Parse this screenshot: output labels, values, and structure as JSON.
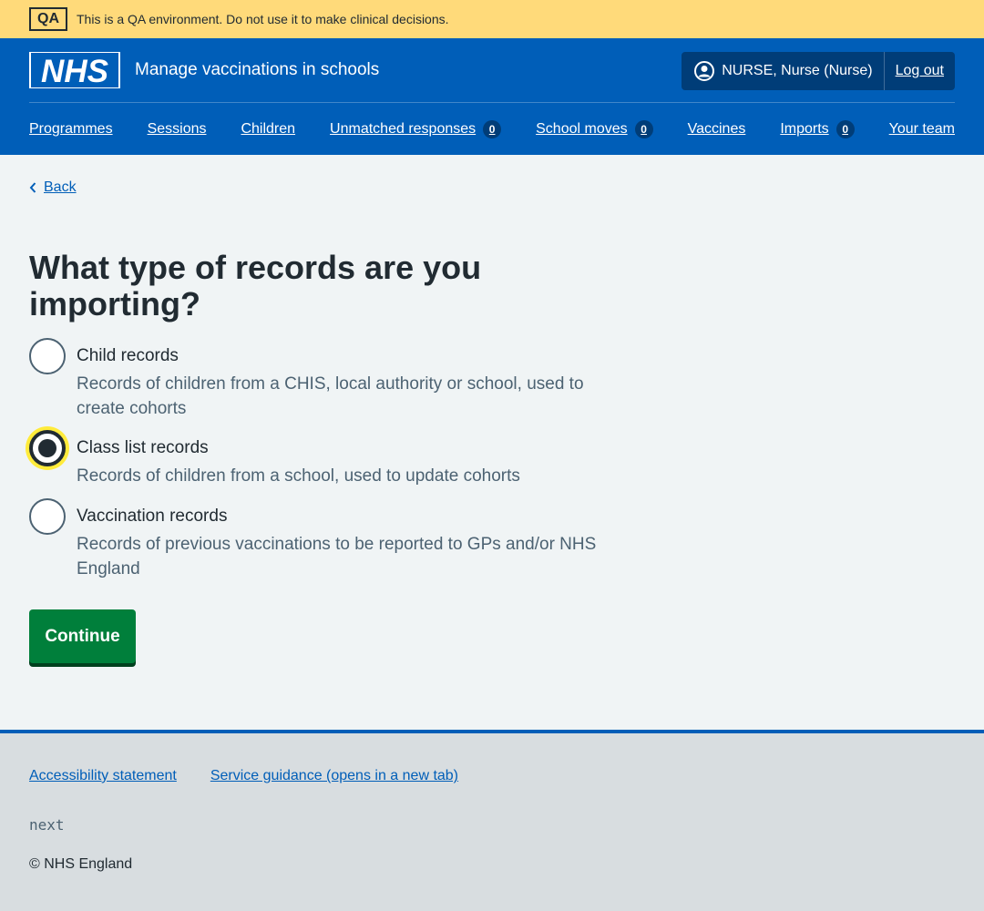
{
  "env_banner": {
    "tag": "QA",
    "message": "This is a QA environment. Do not use it to make clinical decisions."
  },
  "header": {
    "logo_text": "NHS",
    "service_name": "Manage vaccinations in schools",
    "account_name": "NURSE, Nurse (Nurse)",
    "logout_label": "Log out"
  },
  "nav": {
    "programmes": "Programmes",
    "sessions": "Sessions",
    "children": "Children",
    "unmatched": "Unmatched responses",
    "unmatched_count": "0",
    "school_moves": "School moves",
    "school_moves_count": "0",
    "vaccines": "Vaccines",
    "imports": "Imports",
    "imports_count": "0",
    "your_team": "Your team"
  },
  "back_label": "Back",
  "question": "What type of records are you importing?",
  "options": [
    {
      "label": "Child records",
      "hint": "Records of children from a CHIS, local authority or school, used to create cohorts",
      "checked": false
    },
    {
      "label": "Class list records",
      "hint": "Records of children from a school, used to update cohorts",
      "checked": true
    },
    {
      "label": "Vaccination records",
      "hint": "Records of previous vaccinations to be reported to GPs and/or NHS England",
      "checked": false
    }
  ],
  "continue_label": "Continue",
  "footer": {
    "accessibility": "Accessibility statement",
    "guidance": "Service guidance (opens in a new tab)",
    "version": "next",
    "copyright": "© NHS England"
  },
  "colors": {
    "nhs_blue": "#005eb8",
    "button_green": "#007f3b",
    "banner_yellow": "#ffda7a",
    "focus_yellow": "#ffeb3b"
  }
}
